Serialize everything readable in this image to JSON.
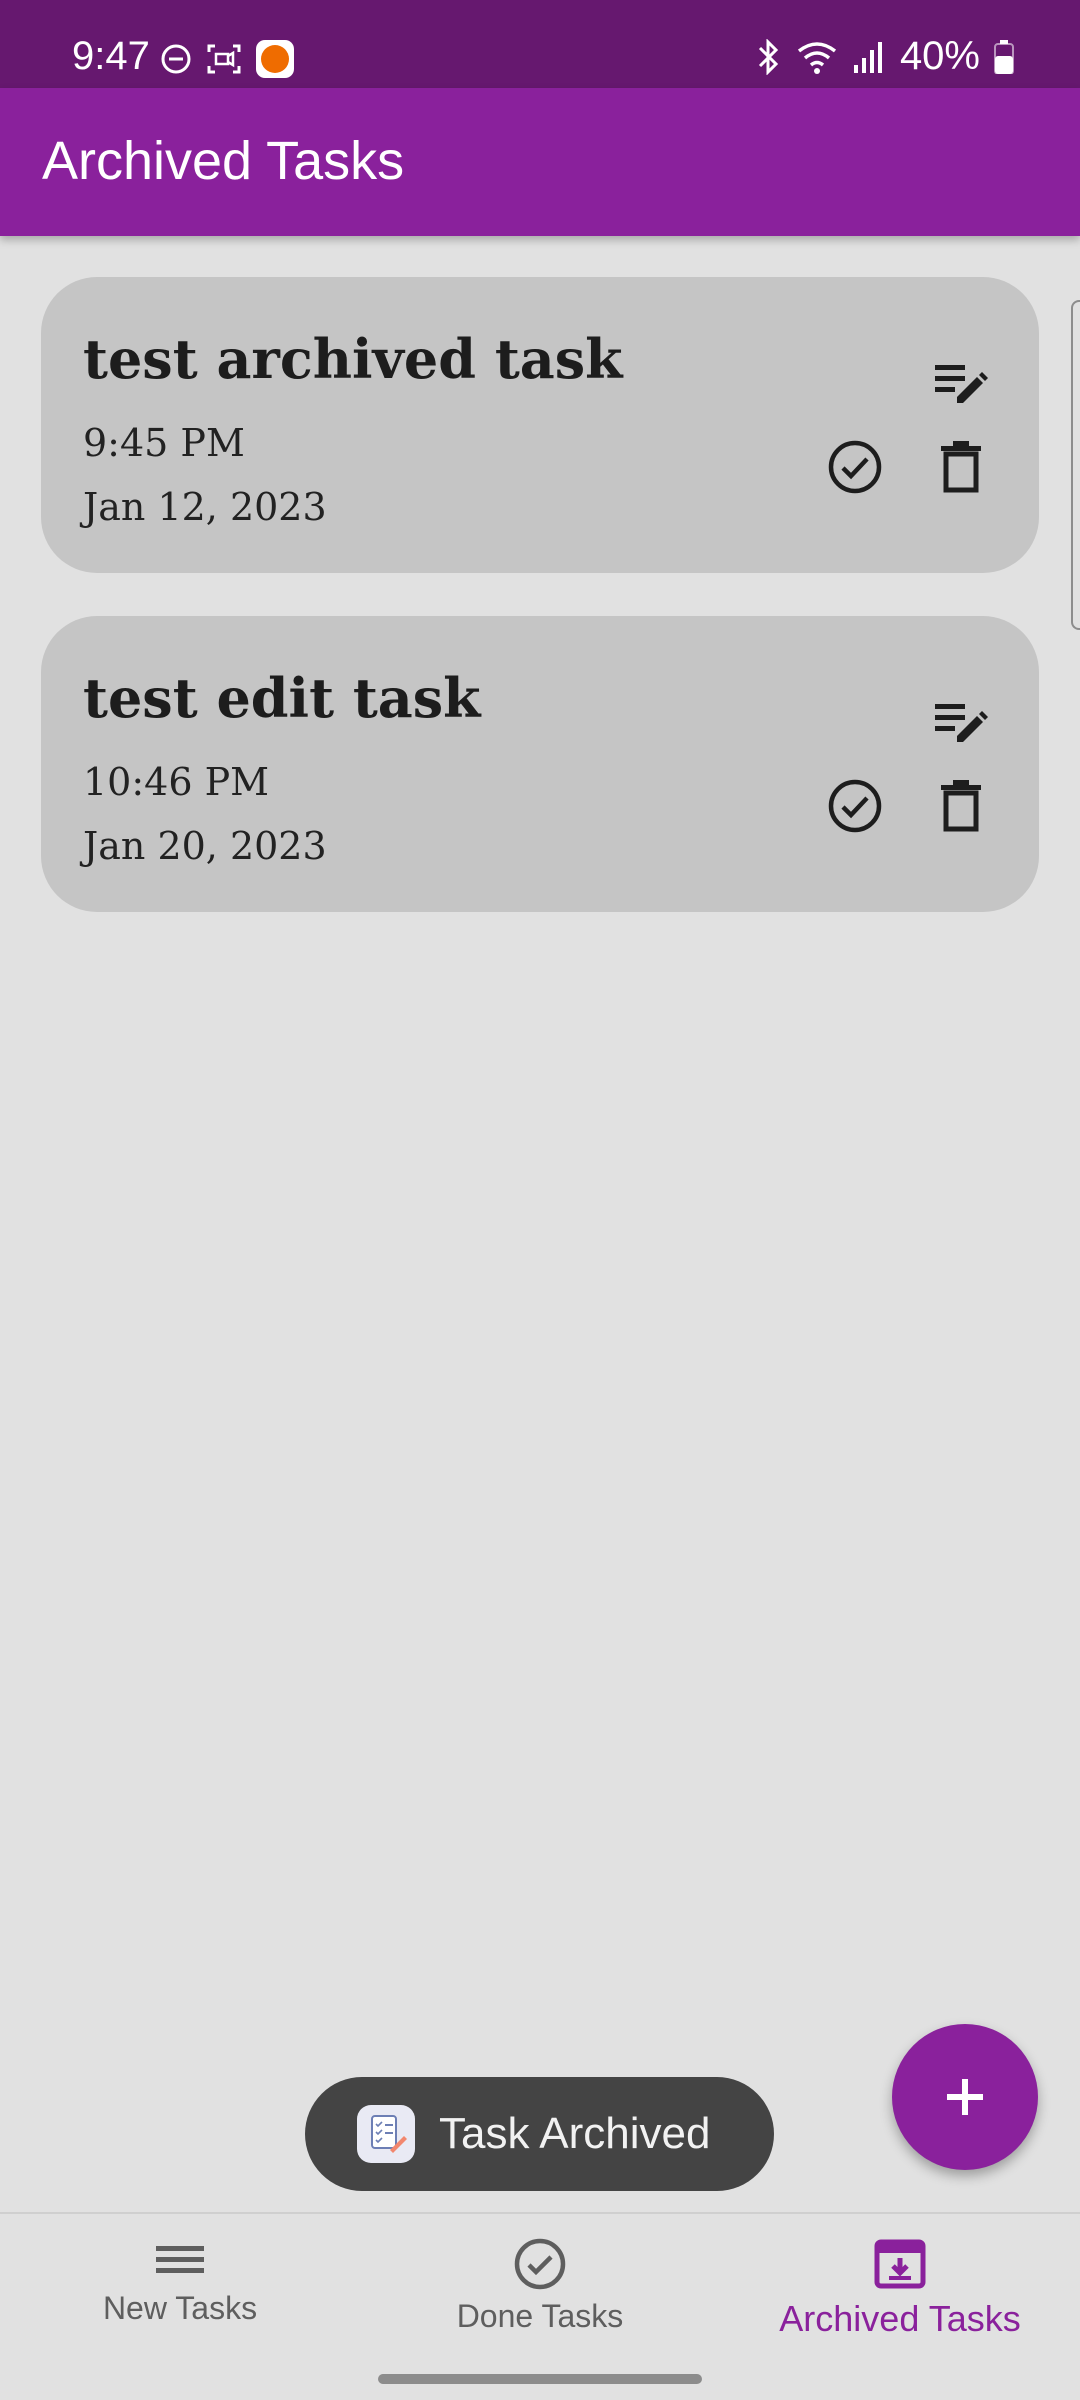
{
  "status_bar": {
    "time": "9:47",
    "battery": "40%",
    "icons": [
      "dnd-icon",
      "screen-record-icon",
      "app-notification-icon",
      "bluetooth-icon",
      "wifi-icon",
      "signal-icon",
      "battery-icon"
    ]
  },
  "app_bar": {
    "title": "Archived Tasks"
  },
  "tasks": [
    {
      "title": "test archived task",
      "time": "9:45 PM",
      "date": "Jan 12, 2023"
    },
    {
      "title": "test edit task",
      "time": "10:46 PM",
      "date": "Jan 20, 2023"
    }
  ],
  "toast": {
    "text": "Task Archived"
  },
  "fab": {
    "icon": "plus-icon"
  },
  "bottom_nav": {
    "items": [
      {
        "label": "New Tasks",
        "icon": "menu-icon",
        "active": false
      },
      {
        "label": "Done Tasks",
        "icon": "check-circle-icon",
        "active": false
      },
      {
        "label": "Archived Tasks",
        "icon": "archive-icon",
        "active": true
      }
    ]
  },
  "colors": {
    "primary": "#8a219c",
    "status_bar": "#66186f",
    "background": "#e1e1e1",
    "card": "#c5c5c5",
    "toast": "#444444"
  }
}
